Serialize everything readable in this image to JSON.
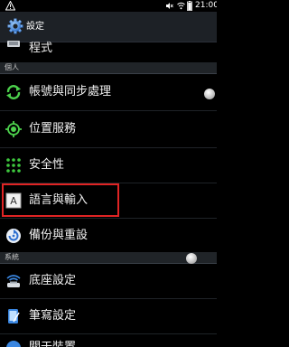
{
  "status_bar": {
    "time": "21:00"
  },
  "header": {
    "title": "設定"
  },
  "sections": {
    "personal": "個人",
    "system": "系統"
  },
  "items": {
    "apps": "程式",
    "accounts_sync": "帳號與同步處理",
    "location": "位置服務",
    "security": "安全性",
    "language_input": "語言與輸入",
    "backup_reset": "備份與重設",
    "dock": "底座設定",
    "pen": "筆寫設定",
    "partial_last": "關于裝置"
  },
  "colors": {
    "highlight_border": "#e02424",
    "title_bar": "#1d2126",
    "section_header": "#202428"
  }
}
